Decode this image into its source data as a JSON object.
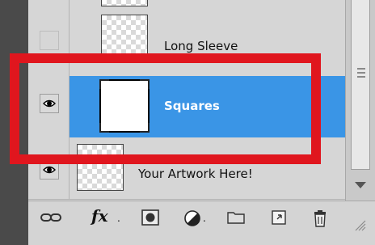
{
  "layers_panel": {
    "layers": [
      {
        "name": "",
        "visible": false
      },
      {
        "name": "Long Sleeve",
        "visible": false
      },
      {
        "name": "Squares",
        "visible": true,
        "selected": true
      },
      {
        "name": "Your Artwork Here!",
        "visible": true
      }
    ]
  },
  "footer": {
    "icons": [
      "link-layers-icon",
      "fx-icon",
      "layer-mask-icon",
      "adjustment-layer-icon",
      "new-group-icon",
      "new-layer-icon",
      "trash-icon"
    ],
    "fx_label": "fx"
  },
  "colors": {
    "selection": "#3a95e6",
    "highlight": "#e0161e"
  }
}
